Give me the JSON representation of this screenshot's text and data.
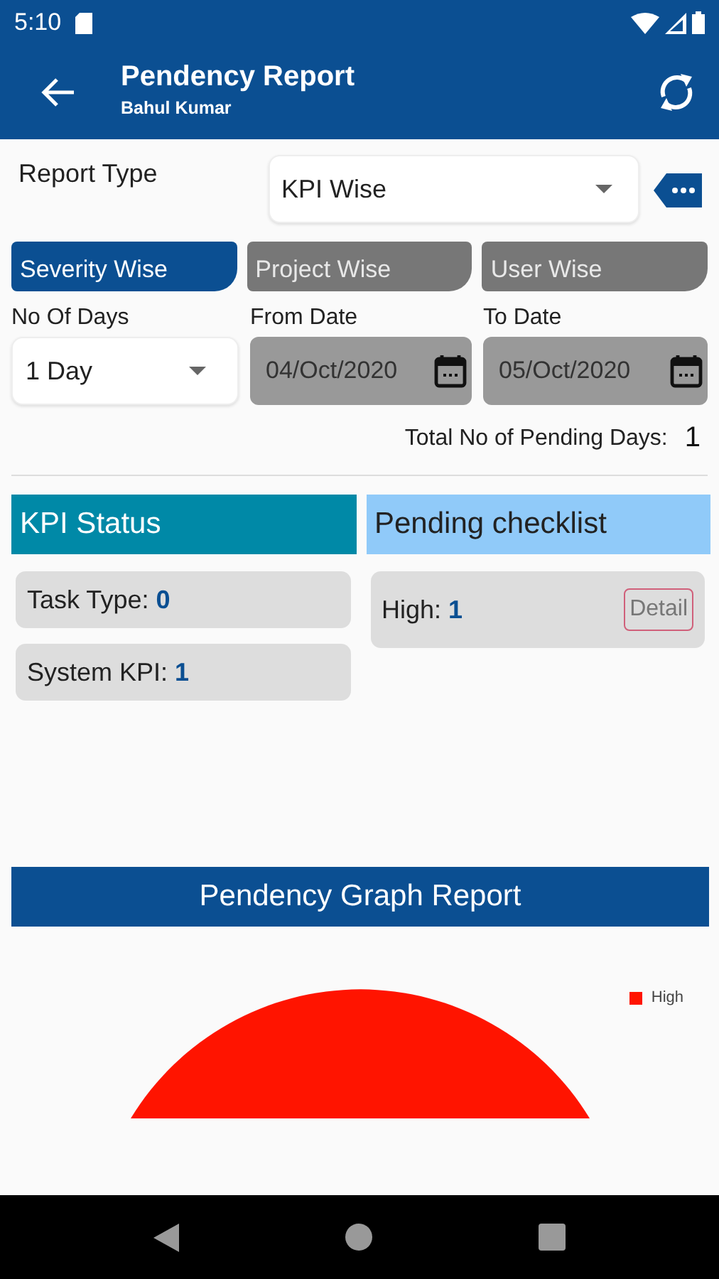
{
  "status_bar": {
    "time": "5:10"
  },
  "app_bar": {
    "title": "Pendency Report",
    "subtitle": "Bahul Kumar"
  },
  "report_type": {
    "label": "Report Type",
    "value": "KPI Wise"
  },
  "tabs": [
    {
      "label": "Severity Wise",
      "selected": true
    },
    {
      "label": "Project Wise",
      "selected": false
    },
    {
      "label": "User Wise",
      "selected": false
    }
  ],
  "filters": {
    "days": {
      "label": "No Of Days",
      "value": "1 Day"
    },
    "from_date": {
      "label": "From Date",
      "value": "04/Oct/2020"
    },
    "to_date": {
      "label": "To Date",
      "value": "05/Oct/2020"
    },
    "total_label": "Total No of Pending Days:",
    "total_value": "1"
  },
  "kpi_status": {
    "title": "KPI Status",
    "items": [
      {
        "label": "Task Type:",
        "value": "0"
      },
      {
        "label": "System KPI:",
        "value": "1"
      }
    ]
  },
  "pending_checklist": {
    "title": "Pending checklist",
    "items": [
      {
        "label": "High:",
        "value": "1",
        "button": "Detail"
      }
    ]
  },
  "graph": {
    "title": "Pendency Graph Report",
    "legend": [
      {
        "label": "High",
        "color": "#ff1400"
      }
    ]
  }
}
